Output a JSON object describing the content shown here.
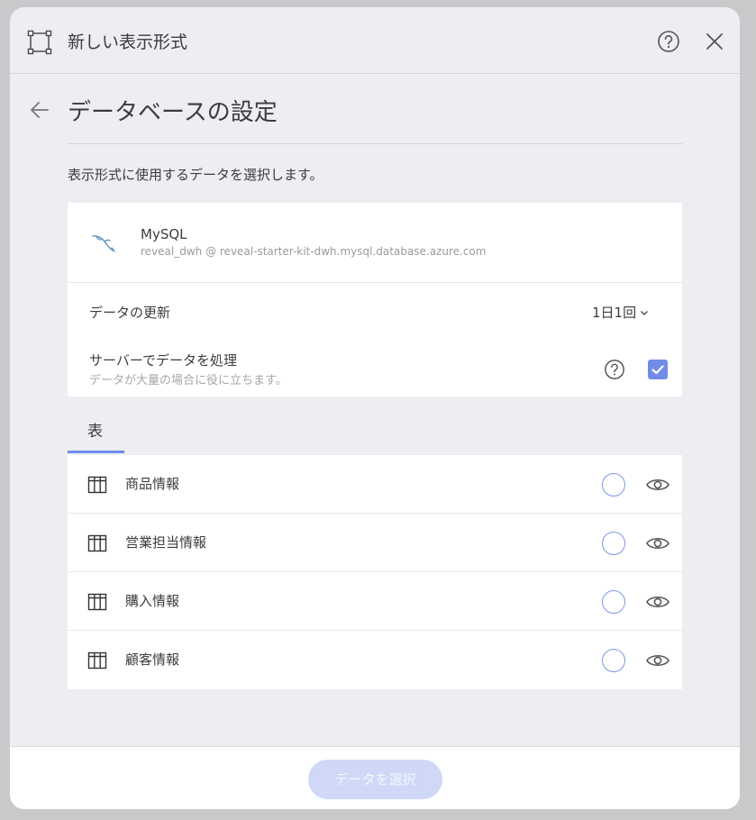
{
  "header": {
    "title": "新しい表示形式"
  },
  "page": {
    "title": "データベースの設定",
    "intro": "表示形式に使用するデータを選択します。"
  },
  "datasource": {
    "name": "MySQL",
    "host": "reveal_dwh @ reveal-starter-kit-dwh.mysql.database.azure.com"
  },
  "settings": {
    "refresh_label": "データの更新",
    "refresh_value": "1日1回",
    "server_label": "サーバーでデータを処理",
    "server_sub": "データが大量の場合に役に立ちます。",
    "server_checked": true
  },
  "tabs": [
    {
      "label": "表"
    }
  ],
  "tables": [
    {
      "label": "商品情報"
    },
    {
      "label": "営業担当情報"
    },
    {
      "label": "購入情報"
    },
    {
      "label": "顧客情報"
    }
  ],
  "footer": {
    "select_label": "データを選択"
  },
  "colors": {
    "accent": "#6f8ce8",
    "button_disabled": "#cfd8f7"
  }
}
